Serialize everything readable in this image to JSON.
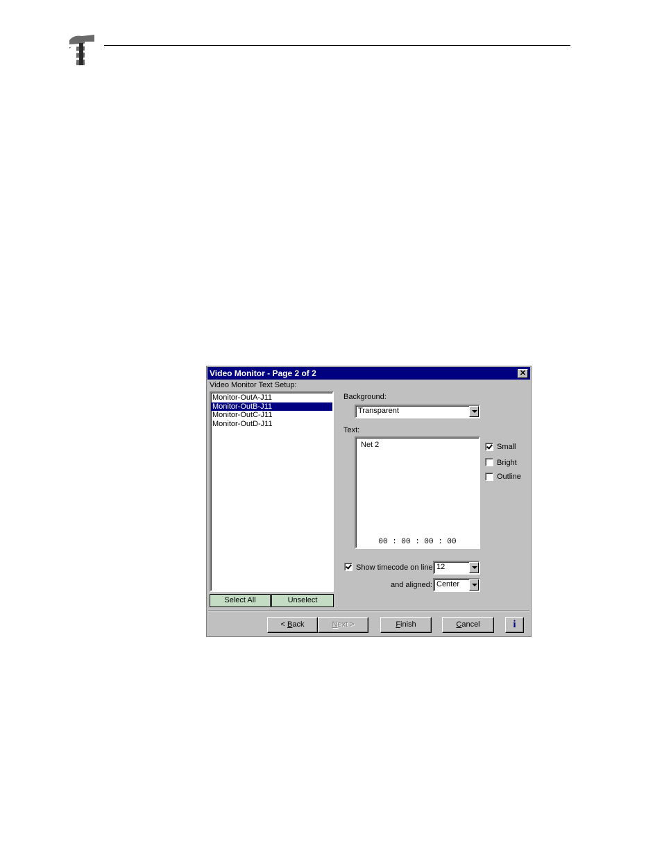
{
  "dialog": {
    "title": "Video Monitor - Page 2 of 2",
    "close_glyph": "✕",
    "setup_label": "Video Monitor Text Setup:",
    "monitors": [
      {
        "label": "Monitor-OutA-J11",
        "selected": false
      },
      {
        "label": "Monitor-OutB-J11",
        "selected": true
      },
      {
        "label": "Monitor-OutC-J11",
        "selected": false
      },
      {
        "label": "Monitor-OutD-J11",
        "selected": false
      }
    ],
    "select_all_label": "Select All",
    "unselect_label": "Unselect",
    "background_label": "Background:",
    "background_value": "Transparent",
    "text_label": "Text:",
    "text_value": "Net 2",
    "timecode_preview": "00 : 00 : 00 : 00",
    "options": [
      {
        "label": "Small",
        "checked": true
      },
      {
        "label": "Bright",
        "checked": false
      },
      {
        "label": "Outline",
        "checked": false
      }
    ],
    "show_timecode_label": "Show timecode on line:",
    "show_timecode_checked": true,
    "line_value": "12",
    "aligned_label": "and aligned:",
    "aligned_value": "Center",
    "buttons": {
      "back": {
        "prefix": "< ",
        "key": "B",
        "rest": "ack"
      },
      "next": {
        "key": "N",
        "rest": "ext >"
      },
      "finish": {
        "key": "F",
        "rest": "inish"
      },
      "cancel": {
        "key": "C",
        "rest": "ancel"
      },
      "info": "i"
    }
  }
}
